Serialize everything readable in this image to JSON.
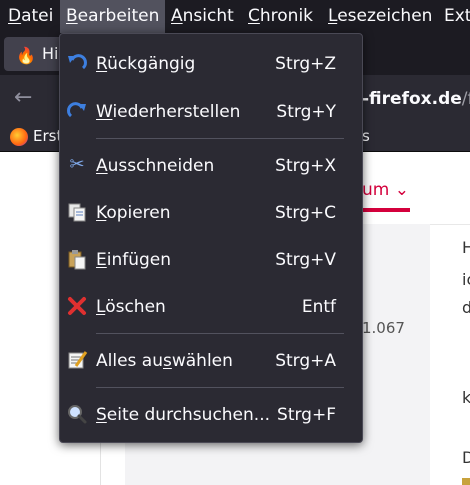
{
  "menubar": {
    "items": [
      {
        "label": "Datei",
        "accel": "D",
        "rest": "atei"
      },
      {
        "label": "Bearbeiten",
        "accel": "B",
        "rest": "earbeiten"
      },
      {
        "label": "Ansicht",
        "accel": "A",
        "rest": "nsicht"
      },
      {
        "label": "Chronik",
        "accel": "C",
        "rest": "hronik"
      },
      {
        "label": "Lesezeichen",
        "accel": "L",
        "rest": "esezeichen"
      },
      {
        "label": "Extr",
        "accel": "",
        "rest": "Extr"
      }
    ]
  },
  "tab": {
    "label": "Hi"
  },
  "toolbar": {
    "url_bold": "-firefox.de",
    "url_rest": "/fo"
  },
  "bookmarks": {
    "first_label": "Erst",
    "second_label": "s"
  },
  "page": {
    "forum_label": "um",
    "stat": "1.067",
    "right_letters": [
      "H",
      "ic",
      "d",
      "k",
      "D"
    ]
  },
  "menu": {
    "items": [
      {
        "pre": "",
        "accel": "R",
        "post": "ückgängig",
        "shortcut": "Strg+Z",
        "icon": "undo-icon"
      },
      {
        "pre": "",
        "accel": "W",
        "post": "iederherstellen",
        "shortcut": "Strg+Y",
        "icon": "redo-icon"
      },
      {
        "pre": "",
        "accel": "A",
        "post": "usschneiden",
        "shortcut": "Strg+X",
        "icon": "scissors-icon"
      },
      {
        "pre": "",
        "accel": "K",
        "post": "opieren",
        "shortcut": "Strg+C",
        "icon": "copy-icon"
      },
      {
        "pre": "",
        "accel": "E",
        "post": "infügen",
        "shortcut": "Strg+V",
        "icon": "paste-icon"
      },
      {
        "pre": "",
        "accel": "L",
        "post": "öschen",
        "shortcut": "Entf",
        "icon": "delete-icon"
      },
      {
        "pre": "Alles au",
        "accel": "s",
        "post": "wählen",
        "shortcut": "Strg+A",
        "icon": "select-all-icon"
      },
      {
        "pre": "",
        "accel": "S",
        "post": "eite durchsuchen...",
        "shortcut": "Strg+F",
        "icon": "search-icon"
      }
    ]
  }
}
